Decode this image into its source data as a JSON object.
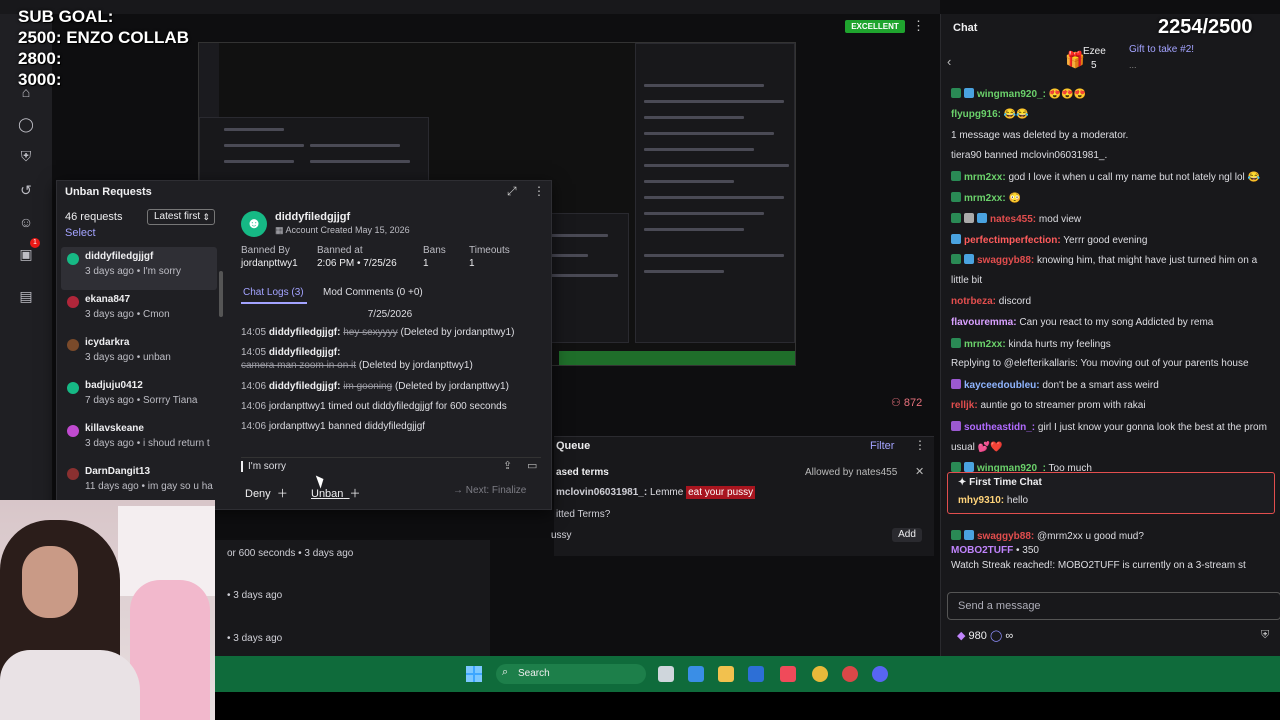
{
  "overlay": {
    "sub_goal_text": "SUB GOAL:\n2500: ENZO COLLAB\n2800:\n3000:",
    "sub_count": "2254/2500"
  },
  "stream": {
    "health_badge": "EXCELLENT",
    "viewer_count": "872"
  },
  "unban_modal": {
    "title": "Unban Requests",
    "request_count": "46 requests",
    "select_label": "Select",
    "sort_label": "Latest first",
    "requests": [
      {
        "name": "diddyfiledgjjgf",
        "meta": "3 days ago • I'm sorry",
        "color": "#16b985"
      },
      {
        "name": "ekana847",
        "meta": "3 days ago • Cmon",
        "color": "#b0263a"
      },
      {
        "name": "icydarkra",
        "meta": "3 days ago • unban",
        "color": "#7a4a2a"
      },
      {
        "name": "badjuju0412",
        "meta": "7 days ago • Sorrry Tiana",
        "color": "#16b985"
      },
      {
        "name": "killavskeane",
        "meta": "3 days ago • i shoud return t",
        "color": "#c04ad0"
      },
      {
        "name": "DarnDangit13",
        "meta": "11 days ago • im gay so u ha",
        "color": "#8a3030"
      }
    ],
    "detail": {
      "name": "diddyfiledgjjgf",
      "created": "Account Created May 15, 2026",
      "banned_by_label": "Banned By",
      "banned_by": "jordanpttwy1",
      "banned_at_label": "Banned at",
      "banned_at": "2:06 PM • 7/25/26",
      "bans_label": "Bans",
      "bans": "1",
      "timeouts_label": "Timeouts",
      "timeouts": "1",
      "tab_chat": "Chat Logs (3)",
      "tab_mod": "Mod Comments (0 +0)",
      "log_date": "7/25/2026",
      "logs": [
        {
          "time": "14:05",
          "user": "diddyfiledgjjgf:",
          "msg": "hey sexyyyy",
          "note": "(Deleted by jordanpttwy1)"
        },
        {
          "time": "14:05",
          "user": "diddyfiledgjjgf:",
          "msg": "camera man zoom in on it",
          "note": "(Deleted by jordanpttwy1)"
        },
        {
          "time": "14:06",
          "user": "diddyfiledgjjgf:",
          "msg": "im gooning",
          "note": "(Deleted by jordanpttwy1)"
        },
        {
          "time": "14:06",
          "text": "jordanpttwy1 timed out diddyfiledgjjgf for 600 seconds"
        },
        {
          "time": "14:06",
          "text": "jordanpttwy1 banned diddyfiledgjjgf"
        }
      ],
      "reply_text": "I'm sorry",
      "deny_label": "Deny",
      "unban_label": "Unban",
      "finalize_label": "Next: Finalize"
    }
  },
  "queue": {
    "title": "Queue",
    "filter_label": "Filter",
    "section_title": "ased terms",
    "allowed_by": "Allowed by nates455",
    "msg_user": "mclovin06031981_:",
    "msg_pre": "Lemme",
    "msg_hl": "eat your pussy",
    "permitted": "itted Terms?",
    "term": "ussy",
    "add_label": "Add"
  },
  "behind_log": [
    "or 600 seconds • 3 days ago",
    "• 3 days ago",
    "• 3 days ago"
  ],
  "chat": {
    "title": "Chat",
    "gifter_name": "Ezee",
    "gifter_count": "5",
    "gift_link": "Gift to take #2!",
    "gift_sub": "...",
    "lines": [
      {
        "user": "wingman920_:",
        "ucolor": "#6bd16b",
        "msg": "😍😍😍",
        "badges": [
          "#2a8a55",
          "#4aa3e0"
        ]
      },
      {
        "user": "flyupg916:",
        "ucolor": "#6bd16b",
        "msg": "😂😂",
        "badges": []
      },
      {
        "user": "",
        "ucolor": "#dedee3",
        "msg": "1 message was deleted by a moderator.",
        "badges": []
      },
      {
        "user": "",
        "ucolor": "#dedee3",
        "msg": "tiera90 banned mclovin06031981_.",
        "badges": []
      },
      {
        "user": "mrm2xx:",
        "ucolor": "#6bd16b",
        "msg": "god I love it when u call my name but not lately ngl lol 😂",
        "badges": [
          "#2a8a55"
        ]
      },
      {
        "user": "mrm2xx:",
        "ucolor": "#6bd16b",
        "msg": "😳",
        "badges": [
          "#2a8a55"
        ]
      },
      {
        "user": "nates455:",
        "ucolor": "#e24e4e",
        "msg": "mod view",
        "badges": [
          "#2a8a55",
          "#aaaaaa",
          "#4aa3e0"
        ]
      },
      {
        "user": "perfectimperfection:",
        "ucolor": "#ff5c5c",
        "msg": "Yerrr good evening",
        "badges": [
          "#4aa3e0"
        ]
      },
      {
        "user": "swaggyb88:",
        "ucolor": "#e24e4e",
        "msg": "knowing him, that might have just turned him on a",
        "badges": [
          "#2a8a55",
          "#4aa3e0"
        ]
      },
      {
        "user": "",
        "ucolor": "#dedee3",
        "msg": "little bit",
        "badges": []
      },
      {
        "user": "notrbeza:",
        "ucolor": "#e24e4e",
        "msg": "discord",
        "badges": []
      },
      {
        "user": "flavouremma:",
        "ucolor": "#d8a0ff",
        "msg": "Can you react to my song Addicted by rema",
        "badges": []
      },
      {
        "user": "mrm2xx:",
        "ucolor": "#6bd16b",
        "msg": "kinda hurts my feelings",
        "badges": [
          "#2a8a55"
        ]
      },
      {
        "user": "",
        "ucolor": "#bdbdc4",
        "msg": "Replying to @elefterikallaris: You moving out of your parents house",
        "badges": []
      },
      {
        "user": "kayceedoubleu:",
        "ucolor": "#8fb5ff",
        "msg": "don't be a smart ass weird",
        "badges": [
          "#9b59d0"
        ]
      },
      {
        "user": "relljk:",
        "ucolor": "#e24e4e",
        "msg": "auntie go to streamer prom with rakai",
        "badges": []
      },
      {
        "user": "southeastidn_:",
        "ucolor": "#b16bff",
        "msg": "girl I just know your gonna look the best at the prom",
        "badges": [
          "#9b59d0"
        ]
      },
      {
        "user": "",
        "ucolor": "#dedee3",
        "msg": "usual 💕❤️",
        "badges": []
      },
      {
        "user": "wingman920_:",
        "ucolor": "#6bd16b",
        "msg": "Too much",
        "badges": [
          "#2a8a55",
          "#4aa3e0"
        ]
      }
    ],
    "first_time_title": "First Time Chat",
    "first_time_user": "mhy9310:",
    "first_time_msg": "hello",
    "after_lines": [
      {
        "user": "swaggyb88:",
        "ucolor": "#e24e4e",
        "msg": "@mrm2xx u good mud?",
        "badges": [
          "#2a8a55",
          "#4aa3e0"
        ]
      },
      {
        "user": "MOBO2TUFF",
        "ucolor": "#c084fc",
        "msg": "• 350",
        "badges": []
      },
      {
        "user": "",
        "ucolor": "#dedee3",
        "msg": "Watch Streak reached!: MOBO2TUFF is currently on a 3-stream st",
        "badges": []
      }
    ],
    "send_placeholder": "Send a message",
    "bits": "980",
    "bits_suffix": "∞"
  },
  "taskbar": {
    "search_label": "Search"
  }
}
